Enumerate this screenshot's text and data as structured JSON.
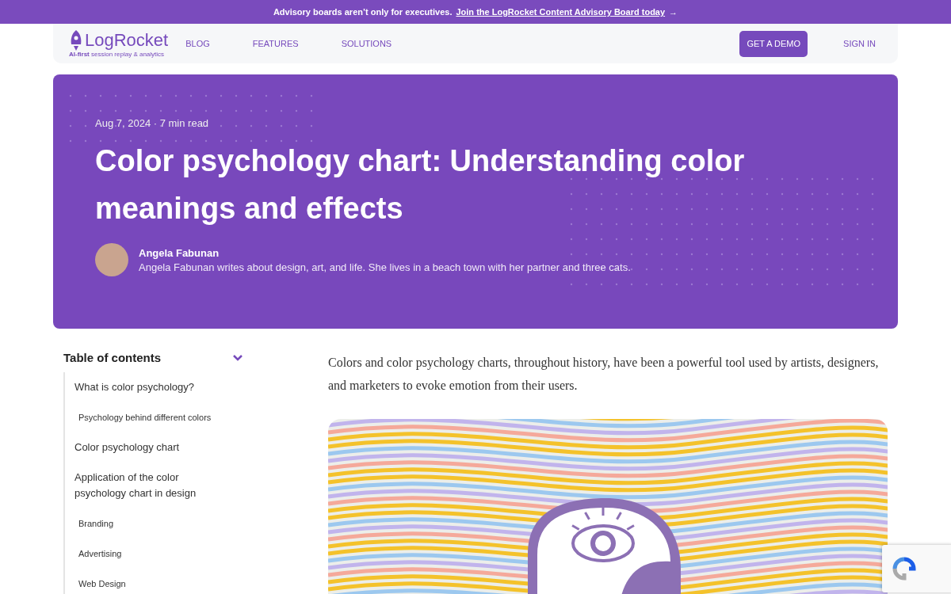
{
  "announcement": {
    "text": "Advisory boards aren’t only for executives.",
    "link": "Join the LogRocket Content Advisory Board today",
    "arrow": "→"
  },
  "nav": {
    "logo": "LogRocket",
    "tagline_bold": "AI-first",
    "tagline": "session replay & analytics",
    "links": [
      "BLOG",
      "FEATURES",
      "SOLUTIONS"
    ],
    "demo_button": "GET A DEMO",
    "sign_in": "SIGN IN"
  },
  "hero": {
    "meta": "Aug 7, 2024 · 7 min read",
    "title": "Color psychology chart: Understanding color meanings and effects",
    "author": {
      "name": "Angela Fabunan",
      "bio": "Angela Fabunan writes about design, art, and life. She lives in a beach town with her partner and three cats."
    }
  },
  "toc": {
    "title": "Table of contents",
    "expanded": true,
    "items": [
      {
        "kind": "main",
        "label": "What is color psychology?"
      },
      {
        "kind": "sub",
        "label": "Psychology behind different colors"
      },
      {
        "kind": "main",
        "label": "Color psychology chart"
      },
      {
        "kind": "main",
        "label": "Application of the color psychology chart in design"
      },
      {
        "kind": "sub",
        "label": "Branding"
      },
      {
        "kind": "sub",
        "label": "Advertising"
      },
      {
        "kind": "sub",
        "label": "Web Design"
      }
    ]
  },
  "article": {
    "intro": "Colors and color psychology charts, throughout history, have been a powerful tool used by artists, designers, and marketers to evoke emotion from their users."
  }
}
